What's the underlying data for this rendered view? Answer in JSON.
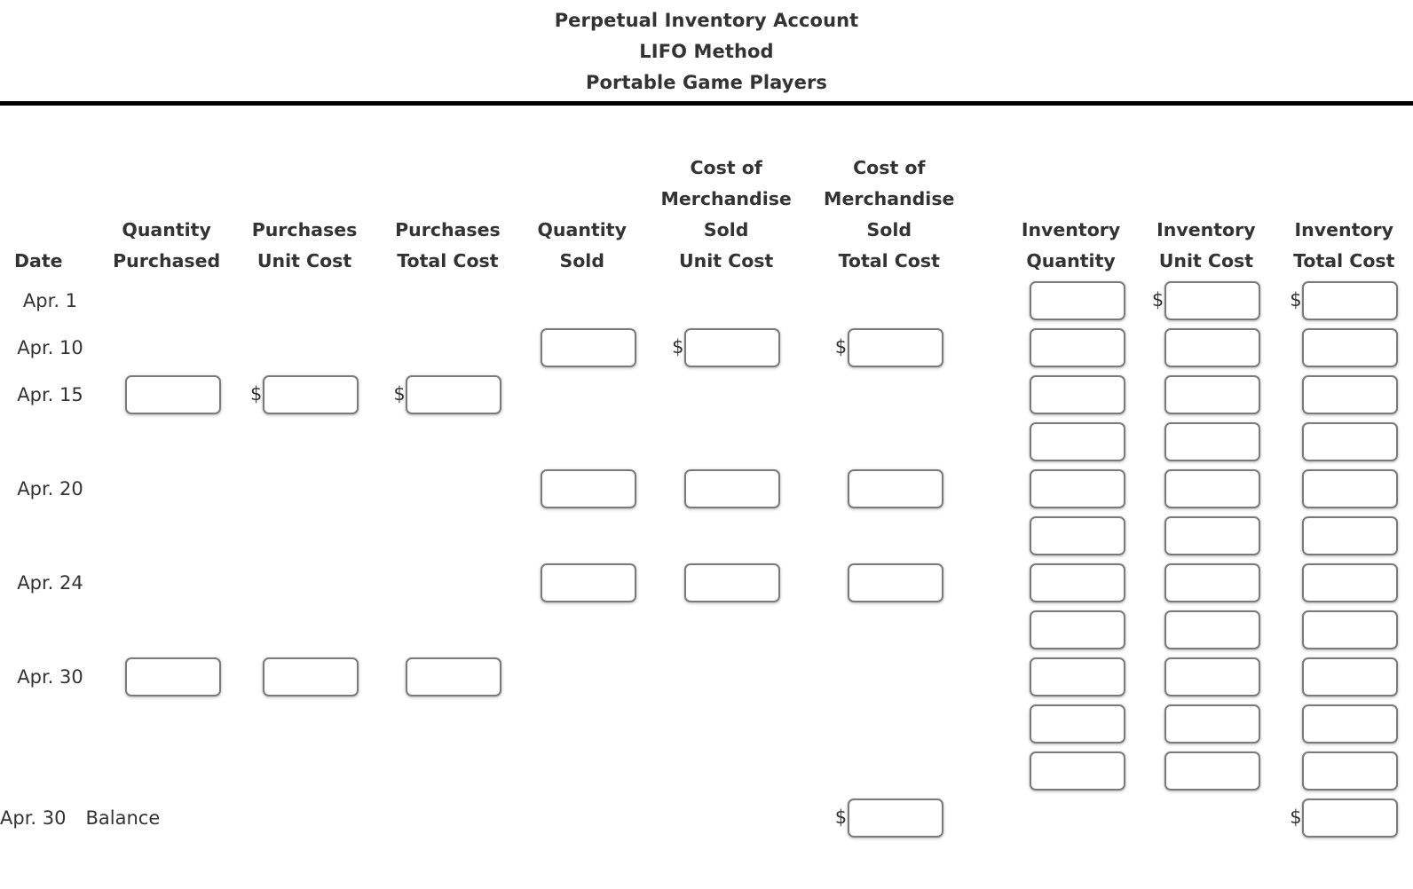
{
  "title": {
    "line1": "Perpetual Inventory Account",
    "line2": "LIFO Method",
    "line3": "Portable Game Players"
  },
  "columns": {
    "date": "Date",
    "quantity_purchased": "Quantity\nPurchased",
    "quantity_purchased_l1": "Quantity",
    "quantity_purchased_l2": "Purchased",
    "purchases_unit_cost_l1": "Purchases",
    "purchases_unit_cost_l2": "Unit Cost",
    "purchases_total_cost_l1": "Purchases",
    "purchases_total_cost_l2": "Total Cost",
    "quantity_sold_l1": "Quantity",
    "quantity_sold_l2": "Sold",
    "cogs_unit_cost_l1": "Cost of",
    "cogs_unit_cost_l2": "Merchandise",
    "cogs_unit_cost_l3": "Sold",
    "cogs_unit_cost_l4": "Unit Cost",
    "cogs_total_cost_l1": "Cost of",
    "cogs_total_cost_l2": "Merchandise",
    "cogs_total_cost_l3": "Sold",
    "cogs_total_cost_l4": "Total Cost",
    "inventory_quantity_l1": "Inventory",
    "inventory_quantity_l2": "Quantity",
    "inventory_unit_cost_l1": "Inventory",
    "inventory_unit_cost_l2": "Unit Cost",
    "inventory_total_cost_l1": "Inventory",
    "inventory_total_cost_l2": "Total Cost"
  },
  "currency_symbol": "$",
  "balance_label": "Balance",
  "rows": [
    {
      "date": "Apr. 1",
      "quantity_purchased": null,
      "purchases_unit_cost": null,
      "purchases_total_cost": null,
      "quantity_sold": null,
      "cogs_unit_cost": null,
      "cogs_total_cost": null,
      "inventory_quantity": {
        "value": "",
        "dollar": false
      },
      "inventory_unit_cost": {
        "value": "",
        "dollar": true
      },
      "inventory_total_cost": {
        "value": "",
        "dollar": true
      }
    },
    {
      "date": "Apr. 10",
      "quantity_purchased": null,
      "purchases_unit_cost": null,
      "purchases_total_cost": null,
      "quantity_sold": {
        "value": "",
        "dollar": false
      },
      "cogs_unit_cost": {
        "value": "",
        "dollar": true
      },
      "cogs_total_cost": {
        "value": "",
        "dollar": true
      },
      "inventory_quantity": {
        "value": "",
        "dollar": false
      },
      "inventory_unit_cost": {
        "value": "",
        "dollar": false
      },
      "inventory_total_cost": {
        "value": "",
        "dollar": false
      }
    },
    {
      "date": "Apr. 15",
      "quantity_purchased": {
        "value": "",
        "dollar": false
      },
      "purchases_unit_cost": {
        "value": "",
        "dollar": true
      },
      "purchases_total_cost": {
        "value": "",
        "dollar": true
      },
      "quantity_sold": null,
      "cogs_unit_cost": null,
      "cogs_total_cost": null,
      "inventory_quantity": {
        "value": "",
        "dollar": false
      },
      "inventory_unit_cost": {
        "value": "",
        "dollar": false
      },
      "inventory_total_cost": {
        "value": "",
        "dollar": false
      }
    },
    {
      "date": "",
      "quantity_purchased": null,
      "purchases_unit_cost": null,
      "purchases_total_cost": null,
      "quantity_sold": null,
      "cogs_unit_cost": null,
      "cogs_total_cost": null,
      "inventory_quantity": {
        "value": "",
        "dollar": false
      },
      "inventory_unit_cost": {
        "value": "",
        "dollar": false
      },
      "inventory_total_cost": {
        "value": "",
        "dollar": false
      }
    },
    {
      "date": "Apr. 20",
      "quantity_purchased": null,
      "purchases_unit_cost": null,
      "purchases_total_cost": null,
      "quantity_sold": {
        "value": "",
        "dollar": false
      },
      "cogs_unit_cost": {
        "value": "",
        "dollar": false
      },
      "cogs_total_cost": {
        "value": "",
        "dollar": false
      },
      "inventory_quantity": {
        "value": "",
        "dollar": false
      },
      "inventory_unit_cost": {
        "value": "",
        "dollar": false
      },
      "inventory_total_cost": {
        "value": "",
        "dollar": false
      }
    },
    {
      "date": "",
      "quantity_purchased": null,
      "purchases_unit_cost": null,
      "purchases_total_cost": null,
      "quantity_sold": null,
      "cogs_unit_cost": null,
      "cogs_total_cost": null,
      "inventory_quantity": {
        "value": "",
        "dollar": false
      },
      "inventory_unit_cost": {
        "value": "",
        "dollar": false
      },
      "inventory_total_cost": {
        "value": "",
        "dollar": false
      }
    },
    {
      "date": "Apr. 24",
      "quantity_purchased": null,
      "purchases_unit_cost": null,
      "purchases_total_cost": null,
      "quantity_sold": {
        "value": "",
        "dollar": false
      },
      "cogs_unit_cost": {
        "value": "",
        "dollar": false
      },
      "cogs_total_cost": {
        "value": "",
        "dollar": false
      },
      "inventory_quantity": {
        "value": "",
        "dollar": false
      },
      "inventory_unit_cost": {
        "value": "",
        "dollar": false
      },
      "inventory_total_cost": {
        "value": "",
        "dollar": false
      }
    },
    {
      "date": "",
      "quantity_purchased": null,
      "purchases_unit_cost": null,
      "purchases_total_cost": null,
      "quantity_sold": null,
      "cogs_unit_cost": null,
      "cogs_total_cost": null,
      "inventory_quantity": {
        "value": "",
        "dollar": false
      },
      "inventory_unit_cost": {
        "value": "",
        "dollar": false
      },
      "inventory_total_cost": {
        "value": "",
        "dollar": false
      }
    },
    {
      "date": "Apr. 30",
      "quantity_purchased": {
        "value": "",
        "dollar": false
      },
      "purchases_unit_cost": {
        "value": "",
        "dollar": false
      },
      "purchases_total_cost": {
        "value": "",
        "dollar": false
      },
      "quantity_sold": null,
      "cogs_unit_cost": null,
      "cogs_total_cost": null,
      "inventory_quantity": {
        "value": "",
        "dollar": false
      },
      "inventory_unit_cost": {
        "value": "",
        "dollar": false
      },
      "inventory_total_cost": {
        "value": "",
        "dollar": false
      }
    },
    {
      "date": "",
      "quantity_purchased": null,
      "purchases_unit_cost": null,
      "purchases_total_cost": null,
      "quantity_sold": null,
      "cogs_unit_cost": null,
      "cogs_total_cost": null,
      "inventory_quantity": {
        "value": "",
        "dollar": false
      },
      "inventory_unit_cost": {
        "value": "",
        "dollar": false
      },
      "inventory_total_cost": {
        "value": "",
        "dollar": false
      }
    },
    {
      "date": "",
      "quantity_purchased": null,
      "purchases_unit_cost": null,
      "purchases_total_cost": null,
      "quantity_sold": null,
      "cogs_unit_cost": null,
      "cogs_total_cost": null,
      "inventory_quantity": {
        "value": "",
        "dollar": false
      },
      "inventory_unit_cost": {
        "value": "",
        "dollar": false
      },
      "inventory_total_cost": {
        "value": "",
        "dollar": false
      }
    },
    {
      "date": "Apr. 30",
      "balance": "Balance",
      "quantity_purchased": null,
      "purchases_unit_cost": null,
      "purchases_total_cost": null,
      "quantity_sold": null,
      "cogs_unit_cost": null,
      "cogs_total_cost": {
        "value": "",
        "dollar": true
      },
      "inventory_quantity": null,
      "inventory_unit_cost": null,
      "inventory_total_cost": {
        "value": "",
        "dollar": true
      }
    }
  ]
}
